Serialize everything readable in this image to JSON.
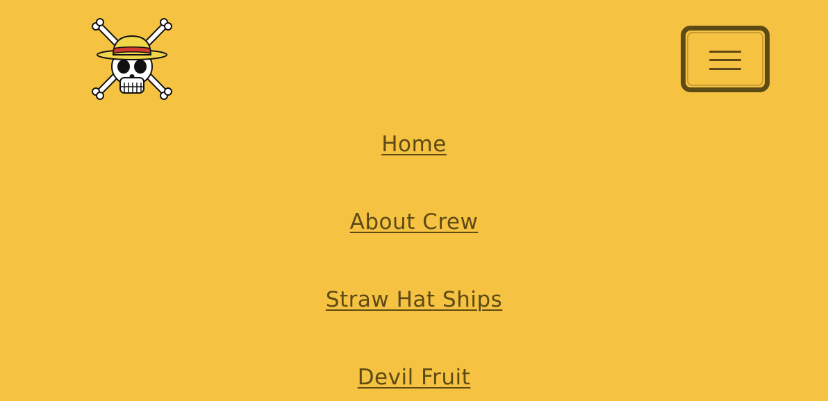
{
  "theme": {
    "background": "#f5c242",
    "link_color": "#5e4a14",
    "button_border": "#5e4a14"
  },
  "header": {
    "logo_icon": "straw-hat-jolly-roger-icon",
    "menu_icon": "hamburger-icon"
  },
  "nav": {
    "items": [
      {
        "label": "Home"
      },
      {
        "label": "About Crew"
      },
      {
        "label": "Straw Hat Ships"
      },
      {
        "label": "Devil Fruit"
      }
    ]
  }
}
